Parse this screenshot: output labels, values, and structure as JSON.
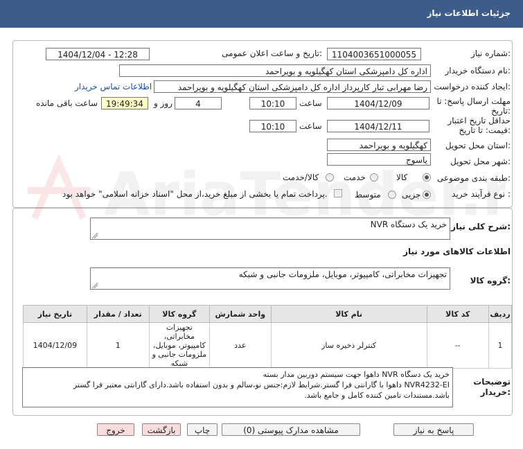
{
  "header": {
    "title": "جزئیات اطلاعات نیاز"
  },
  "fields": {
    "need_number_label": "شماره نیاز:",
    "need_number": "1104003651000055",
    "announce_label": "تاریخ و ساعت اعلان عمومی:",
    "announce_value": "1404/12/04 - 12:28",
    "buyer_org_label": "نام دستگاه خریدار:",
    "buyer_org": "اداره کل دامپزشکی استان کهگیلویه و بویراحمد",
    "requester_label": "ایجاد کننده درخواست:",
    "requester": "رضا مهرابی تبار کارپرداز اداره کل دامپزشکی استان کهگیلویه و بویراحمد",
    "contact_link": "اطلاعات تماس خریدار",
    "reply_deadline_label_1": "مهلت ارسال پاسخ: تا",
    "reply_deadline_label_2": "تاریخ:",
    "reply_date": "1404/12/09",
    "time_label": "ساعت",
    "reply_time": "10:10",
    "days": "4",
    "days_label": "روز و",
    "remaining_time": "19:49:34",
    "remaining_label": "ساعت باقی مانده",
    "validity_label_1": "حداقل تاریخ اعتبار",
    "validity_label_2": "قیمت: تا تاریخ:",
    "validity_date": "1404/12/11",
    "validity_time": "10:10",
    "province_label": "استان محل تحویل:",
    "province": "کهگیلویه و بویراحمد",
    "city_label": "شهر محل تحویل:",
    "city": "یاسوج",
    "category_label": "طبقه بندی موضوعی:",
    "category_options": [
      "کالا",
      "خدمت",
      "کالا/خدمت"
    ],
    "process_label": "نوع فرآیند خرید :",
    "process_options": [
      "جزیی",
      "متوسط"
    ],
    "payment_note": "پرداخت تمام یا بخشی از مبلغ خرید،از محل \"اسناد خزانه اسلامی\" خواهد بود."
  },
  "description": {
    "label": "شرح کلی نیاز:",
    "value": "خرید یک دستگاه NVR"
  },
  "goods_info": {
    "title": "اطلاعات کالاهای مورد نیاز",
    "group_label": "گروه کالا:",
    "group_value": "تجهیزات مخابراتی، کامپیوتر، موبایل، ملزومات جانبی و شبکه"
  },
  "table": {
    "headers": [
      "ردیف",
      "کد کالا",
      "نام کالا",
      "واحد شمارش",
      "گروه کالا",
      "تعداد / مقدار",
      "تاریخ نیاز"
    ],
    "rows": [
      [
        "1",
        "--",
        "کنترلر ذخیره ساز",
        "عدد",
        "تجهیزات مخابراتی، کامپیوتر، موبایل، ملزومات جانبی و شبکه",
        "1",
        "1404/12/09"
      ]
    ]
  },
  "buyer_notes": {
    "label_1": "توضیحات",
    "label_2": "خریدار:",
    "line1": "خرید یک دسگاه NVR داهوا جهت سیستم دوربین مدار بسته",
    "line2": "NVR4232-EI داهوا با گارانتی فرا گستر.شرایط لازم:جنس نو،سالم و بدون استفاده باشد.دارای گارانتی معتبر فرا گستر",
    "line3": "باشد.مستندات تامین کننده کامل و جامع باشد."
  },
  "buttons": {
    "reply": "پاسخ به نیاز",
    "view_docs": "مشاهده مدارک پیوستی (0)",
    "print": "چاپ",
    "back": "بازگشت",
    "exit": "خروج"
  },
  "watermark": "AriaTender.net"
}
